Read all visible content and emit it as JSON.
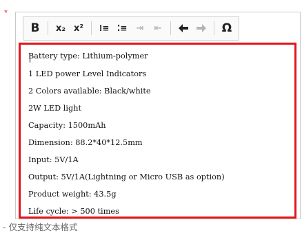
{
  "form": {
    "required_mark": "*",
    "hint": "- 仅支持纯文本格式"
  },
  "toolbar": {
    "bold": "B",
    "subscript": "x₂",
    "superscript": "x²",
    "ordered_list": "⁝≡",
    "unordered_list": "⁚≡",
    "indent": "⇥",
    "outdent": "⇤",
    "undo": "◆",
    "redo": "➦",
    "special_char": "Ω"
  },
  "editor": {
    "lines": [
      "Battery type: Lithium-polymer",
      "1 LED power Level Indicators",
      "2 Colors available: Black/white",
      "2W LED light",
      "Capacity: 1500mAh",
      "Dimension: 88.2*40*12.5mm",
      "Input: 5V/1A",
      "Output: 5V/1A(Lightning or Micro USB as option)",
      "Product weight: 43.5g",
      "Life cycle: > 500 times"
    ]
  }
}
